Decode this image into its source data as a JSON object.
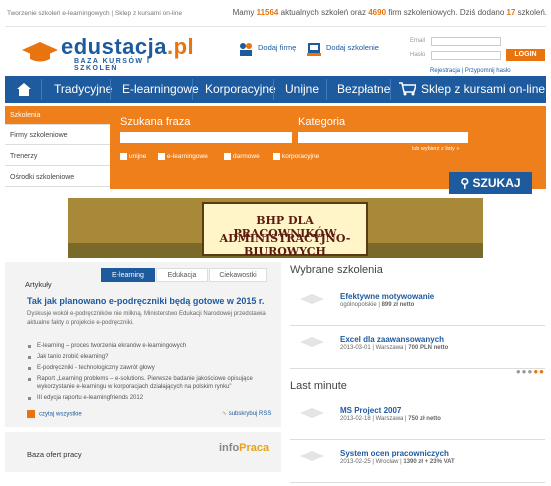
{
  "top": {
    "left_text": "Tworzenie szkoleń e-learningowych | Sklep z kursami on-line",
    "count1": "11564",
    "count2": "4690",
    "count3": "17",
    "prefix": "Mamy ",
    "mid1": " aktualnych szkoleń oraz ",
    "mid2": " firm szkoleniowych. Dziś dodano ",
    "suffix": " szkoleń."
  },
  "logo": {
    "main_a": "edustacja",
    "main_b": ".pl",
    "sub": "BAZA KURSÓW I SZKOLEŃ"
  },
  "header": {
    "add_company": "Dodaj firmę",
    "add_training": "Dodaj szkolenie"
  },
  "login": {
    "email_label": "Email",
    "password_label": "Hasło",
    "button": "LOGIN",
    "links": "Rejestracja | Przypomnij hasło"
  },
  "nav": [
    "Tradycyjne",
    "E-learningowe",
    "Korporacyjne",
    "Unijne",
    "Bezpłatne",
    "Sklep z kursami on-line"
  ],
  "side": [
    "Szkolenia",
    "Firmy szkoleniowe",
    "Trenerzy",
    "Ośrodki szkoleniowe"
  ],
  "search": {
    "phrase_label": "Szukana fraza",
    "category_label": "Kategoria",
    "checkboxes": [
      "unijne",
      "e-learningowe",
      "darmowe",
      "korporacyjne"
    ],
    "more": "lub wybierz z listy »",
    "button": "SZUKAJ"
  },
  "banner": {
    "line1": "BHP DLA PRACOWNIKÓW",
    "line2": "ADMINISTRACYJNO-BIUROWYCH"
  },
  "articles": {
    "tabs": [
      "E-learning",
      "Edukacja",
      "Ciekawostki"
    ],
    "section": "Artykuły",
    "headline": "Tak jak planowano e-podręczniki będą gotowe w 2015 r.",
    "desc": "Dyskusje wokół e-podręczników nie milkną. Ministerstwo Edukacji Narodowej przedstawia aktualne fakty o projekcie e-podręczniki.",
    "items": [
      "E-learning – proces tworzenia ekranów e-learningowych",
      "Jak tanio zrobić elearning?",
      "E-podręczniki - technologiczny zawrót głowy",
      "Raport „Learning problems – e-solutions. Pierwsze badanie jakościowe opisujące wykorzystanie e-learningu w korporacjach działających na polskim rynku\"",
      "III edycja raportu e-learningfriends 2012"
    ],
    "read_all": "czytaj wszystkie",
    "rss": "subskrybuj RSS"
  },
  "baza": {
    "text": "Baza ofert pracy",
    "logo_a": "info",
    "logo_b": "Praca"
  },
  "selected": {
    "title": "Wybrane szkolenia",
    "items": [
      {
        "name": "Efektywne motywowanie",
        "detail_a": "ogólnopolskie | ",
        "price": "899 zł netto"
      },
      {
        "name": "Excel dla zaawansowanych",
        "detail_a": "2013-03-01 | Warszawa | ",
        "price": "700 PLN netto"
      }
    ]
  },
  "last_minute": {
    "title": "Last minute",
    "items": [
      {
        "name": "MS Project 2007",
        "detail_a": "2013-02-18 | Warszawa | ",
        "price": "750 zł netto"
      },
      {
        "name": "System ocen pracowniczych",
        "detail_a": "2013-02-25 | Wrocław | ",
        "price": "1390 zł + 23% VAT"
      }
    ]
  },
  "colors": {
    "blue": "#1d5a9e",
    "orange": "#ef7f1a"
  }
}
